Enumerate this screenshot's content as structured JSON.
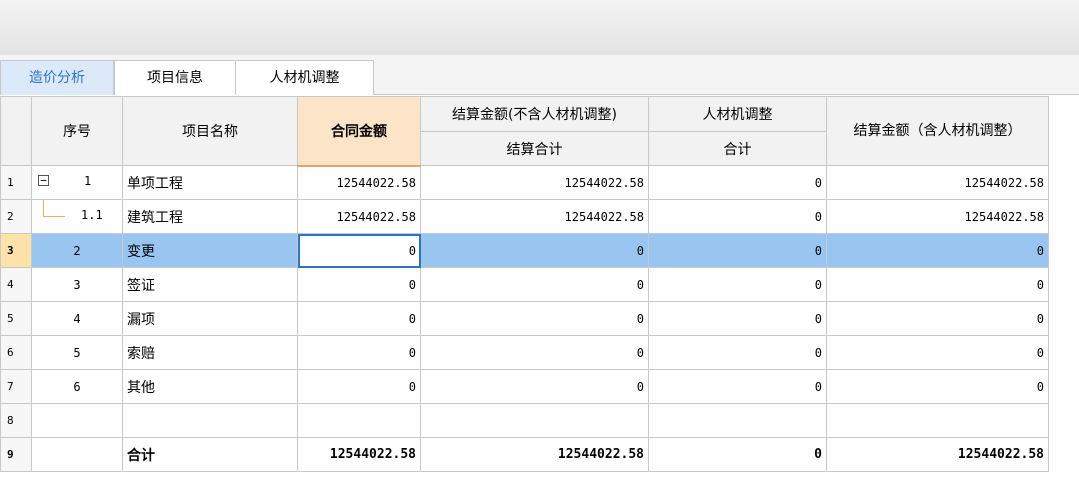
{
  "tabs": [
    {
      "label": "造价分析",
      "active": true
    },
    {
      "label": "项目信息",
      "active": false
    },
    {
      "label": "人材机调整",
      "active": false
    }
  ],
  "headers": {
    "seq": "序号",
    "name": "项目名称",
    "contract": "合同金额",
    "settle_excl_group": "结算金额(不含人材机调整)",
    "settle_excl_sub": "结算合计",
    "adjust_group": "人材机调整",
    "adjust_sub": "合计",
    "settle_incl": "结算金额（含人材机调整）"
  },
  "rows": [
    {
      "rn": "1",
      "seq": "1",
      "name": "单项工程",
      "contract": "12544022.58",
      "settle_excl": "12544022.58",
      "adjust": "0",
      "settle_incl": "12544022.58",
      "toggle": "−"
    },
    {
      "rn": "2",
      "seq": "1.1",
      "name": "建筑工程",
      "contract": "12544022.58",
      "settle_excl": "12544022.58",
      "adjust": "0",
      "settle_incl": "12544022.58"
    },
    {
      "rn": "3",
      "seq": "2",
      "name": "变更",
      "contract": "0",
      "settle_excl": "0",
      "adjust": "0",
      "settle_incl": "0"
    },
    {
      "rn": "4",
      "seq": "3",
      "name": "签证",
      "contract": "0",
      "settle_excl": "0",
      "adjust": "0",
      "settle_incl": "0"
    },
    {
      "rn": "5",
      "seq": "4",
      "name": "漏项",
      "contract": "0",
      "settle_excl": "0",
      "adjust": "0",
      "settle_incl": "0"
    },
    {
      "rn": "6",
      "seq": "5",
      "name": "索赔",
      "contract": "0",
      "settle_excl": "0",
      "adjust": "0",
      "settle_incl": "0"
    },
    {
      "rn": "7",
      "seq": "6",
      "name": "其他",
      "contract": "0",
      "settle_excl": "0",
      "adjust": "0",
      "settle_incl": "0"
    },
    {
      "rn": "8",
      "seq": "",
      "name": "",
      "contract": "",
      "settle_excl": "",
      "adjust": "",
      "settle_incl": ""
    },
    {
      "rn": "9",
      "seq": "",
      "name": "合计",
      "contract": "12544022.58",
      "settle_excl": "12544022.58",
      "adjust": "0",
      "settle_incl": "12544022.58"
    }
  ],
  "selected_row": "3",
  "colors": {
    "tab_active": "#2e74c9",
    "selection": "#99c6f1",
    "highlight_header": "#fce4c8",
    "edit_border": "#2b74c7"
  }
}
